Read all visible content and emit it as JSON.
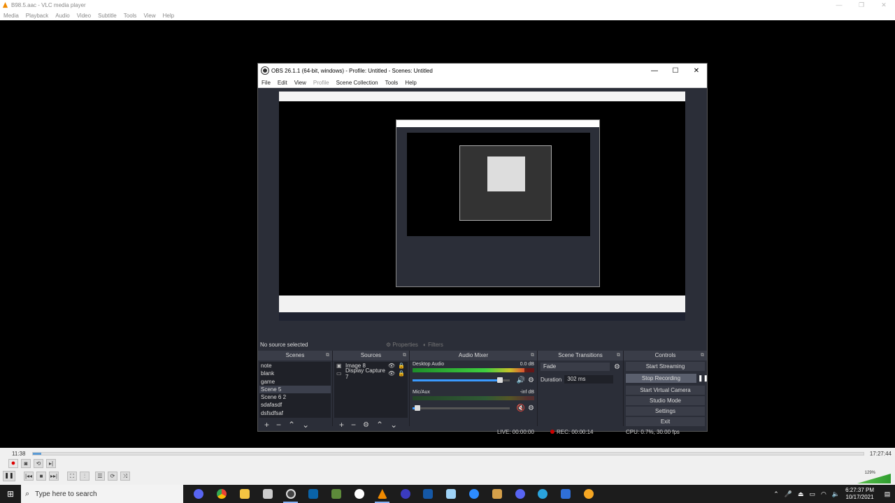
{
  "vlc": {
    "title": "B98.5.aac - VLC media player",
    "menu": [
      "Media",
      "Playback",
      "Audio",
      "Video",
      "Subtitle",
      "Tools",
      "View",
      "Help"
    ],
    "time_elapsed": "11:38",
    "time_total": "17:27:44",
    "seek_progress": 0.01,
    "volume": "129%"
  },
  "obs": {
    "title": "OBS 26.1.1 (64-bit, windows) - Profile: Untitled - Scenes: Untitled",
    "menu": [
      "File",
      "Edit",
      "View",
      "Profile",
      "Scene Collection",
      "Tools",
      "Help"
    ],
    "no_source": "No source selected",
    "properties_label": "Properties",
    "filters_label": "Filters",
    "docks": {
      "scenes": {
        "title": "Scenes",
        "items": [
          "note",
          "blank",
          "game",
          "Scene 5",
          "Scene 6 2",
          "sdafasdf",
          "dsfsdfsaf"
        ],
        "selected_index": 3
      },
      "sources": {
        "title": "Sources",
        "items": [
          {
            "name": "Image 8",
            "type_icon": "image-icon"
          },
          {
            "name": "Display Capture 7",
            "type_icon": "monitor-icon"
          }
        ]
      },
      "mixer": {
        "title": "Audio Mixer",
        "channels": [
          {
            "name": "Desktop Audio",
            "level": "0.0 dB",
            "volume": 0.9,
            "muted": false
          },
          {
            "name": "Mic/Aux",
            "level": "-inf dB",
            "volume": 0.05,
            "muted": true
          }
        ]
      },
      "transitions": {
        "title": "Scene Transitions",
        "type": "Fade",
        "duration_label": "Duration",
        "duration_value": "302 ms"
      },
      "controls": {
        "title": "Controls",
        "buttons": [
          "Start Streaming",
          "Stop Recording",
          "Start Virtual Camera",
          "Studio Mode",
          "Settings",
          "Exit"
        ]
      }
    },
    "status": {
      "live": "LIVE: 00:00:00",
      "rec": "REC: 00:00:14",
      "cpu": "CPU: 0.7%, 30.00 fps"
    }
  },
  "taskbar": {
    "search_placeholder": "Type here to search",
    "time": "6:27:37 PM",
    "date": "10/17/2021"
  }
}
